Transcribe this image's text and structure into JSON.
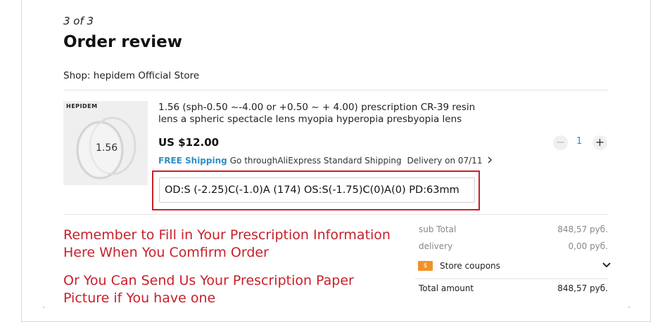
{
  "checkout": {
    "step": "3 of 3",
    "title": "Order review",
    "shop": "Shop: hepidem Official Store"
  },
  "product": {
    "thumb_brand": "HEPIDEM",
    "thumb_number": "1.56",
    "name": "1.56 (sph-0.50 ~-4.00 or +0.50 ~ + 4.00) prescription CR-39 resin lens a spheric spectacle lens myopia hyperopia presbyopia lens",
    "price": "US $12.00",
    "shipping_free": "FREE Shipping",
    "shipping_via": "Go throughAliExpress Standard Shipping",
    "delivery": "Delivery on 07/11",
    "quantity": "1",
    "quantity_minus": "−",
    "quantity_plus": "+",
    "note_value": "OD:S (-2.25)C(-1.0)A (174) OS:S(-1.75)C(0)A(0)  PD:63mm"
  },
  "instructions": {
    "line1a": "Remember to Fill in Your Prescription Information",
    "line1b": "Here When You Comfirm Order",
    "line2a": "Or You Can Send Us Your Prescription Paper",
    "line2b": "Picture if You have one"
  },
  "summary": {
    "subtotal_label": "sub Total",
    "subtotal_value": "848,57 руб.",
    "delivery_label": "delivery",
    "delivery_value": "0,00 руб.",
    "coupons_label": "Store coupons",
    "coupon_icon_text": "$",
    "total_label": "Total amount",
    "total_value": "848,57 руб."
  },
  "colors": {
    "accent_blue": "#2f8fc4",
    "highlight_red": "#c8202a",
    "coupon_orange": "#f29226"
  },
  "icons": [
    "chevron-right-icon",
    "minus-icon",
    "plus-icon",
    "coupon-icon",
    "chevron-down-icon"
  ]
}
